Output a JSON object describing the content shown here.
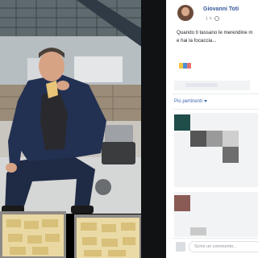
{
  "post": {
    "author": "Giovanni Toti",
    "time": "1 h",
    "text_line1": "Quando ti tassano le merendine m",
    "text_line2": "e hai la focaccia..."
  },
  "comments": {
    "filter_label": "Più pertinenti",
    "input_placeholder": "Scrivi un commento..."
  },
  "colors": {
    "link": "#365899",
    "accent": "#4267b2",
    "panel_bg": "#ffffff",
    "muted": "#90949c"
  }
}
